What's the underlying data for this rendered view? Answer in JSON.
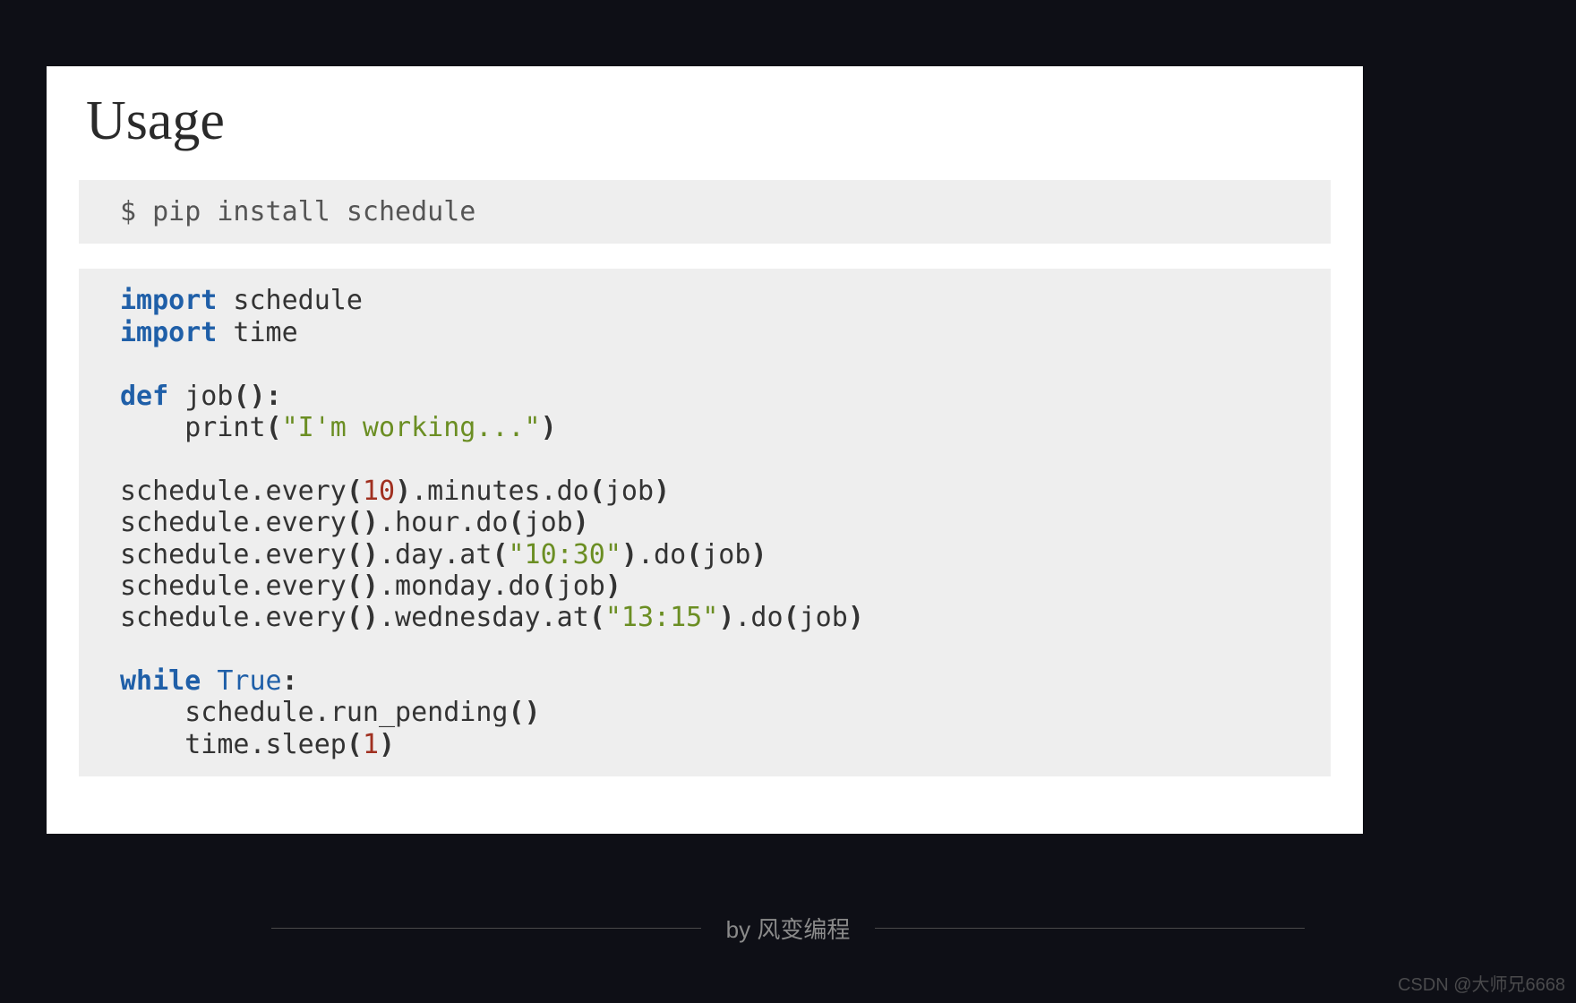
{
  "heading": "Usage",
  "shell_line": "$ pip install schedule",
  "code": {
    "l01_kw": "import",
    "l01_rest": " schedule",
    "l02_kw": "import",
    "l02_rest": " time",
    "blank1": "",
    "l04_kw": "def",
    "l04_name": " job",
    "l04_paren": "():",
    "l05_indent": "    ",
    "l05_fn": "print",
    "l05_open": "(",
    "l05_str": "\"I'm working...\"",
    "l05_close": ")",
    "blank2": "",
    "l07_a": "schedule.every",
    "l07_open": "(",
    "l07_num": "10",
    "l07_close": ")",
    "l07_b": ".minutes.do",
    "l07_open2": "(",
    "l07_arg": "job",
    "l07_close2": ")",
    "l08_a": "schedule.every",
    "l08_p": "()",
    "l08_b": ".hour.do",
    "l08_open2": "(",
    "l08_arg": "job",
    "l08_close2": ")",
    "l09_a": "schedule.every",
    "l09_p": "()",
    "l09_b": ".day.at",
    "l09_open": "(",
    "l09_str": "\"10:30\"",
    "l09_close": ")",
    "l09_c": ".do",
    "l09_open2": "(",
    "l09_arg": "job",
    "l09_close2": ")",
    "l10_a": "schedule.every",
    "l10_p": "()",
    "l10_b": ".monday.do",
    "l10_open2": "(",
    "l10_arg": "job",
    "l10_close2": ")",
    "l11_a": "schedule.every",
    "l11_p": "()",
    "l11_b": ".wednesday.at",
    "l11_open": "(",
    "l11_str": "\"13:15\"",
    "l11_close": ")",
    "l11_c": ".do",
    "l11_open2": "(",
    "l11_arg": "job",
    "l11_close2": ")",
    "blank3": "",
    "l13_kw": "while",
    "l13_sp": " ",
    "l13_true": "True",
    "l13_colon": ":",
    "l14_indent": "    ",
    "l14_a": "schedule.run_pending",
    "l14_p": "()",
    "l15_indent": "    ",
    "l15_a": "time.sleep",
    "l15_open": "(",
    "l15_num": "1",
    "l15_close": ")"
  },
  "footer": "by 风变编程",
  "watermark": "CSDN @大师兄6668"
}
